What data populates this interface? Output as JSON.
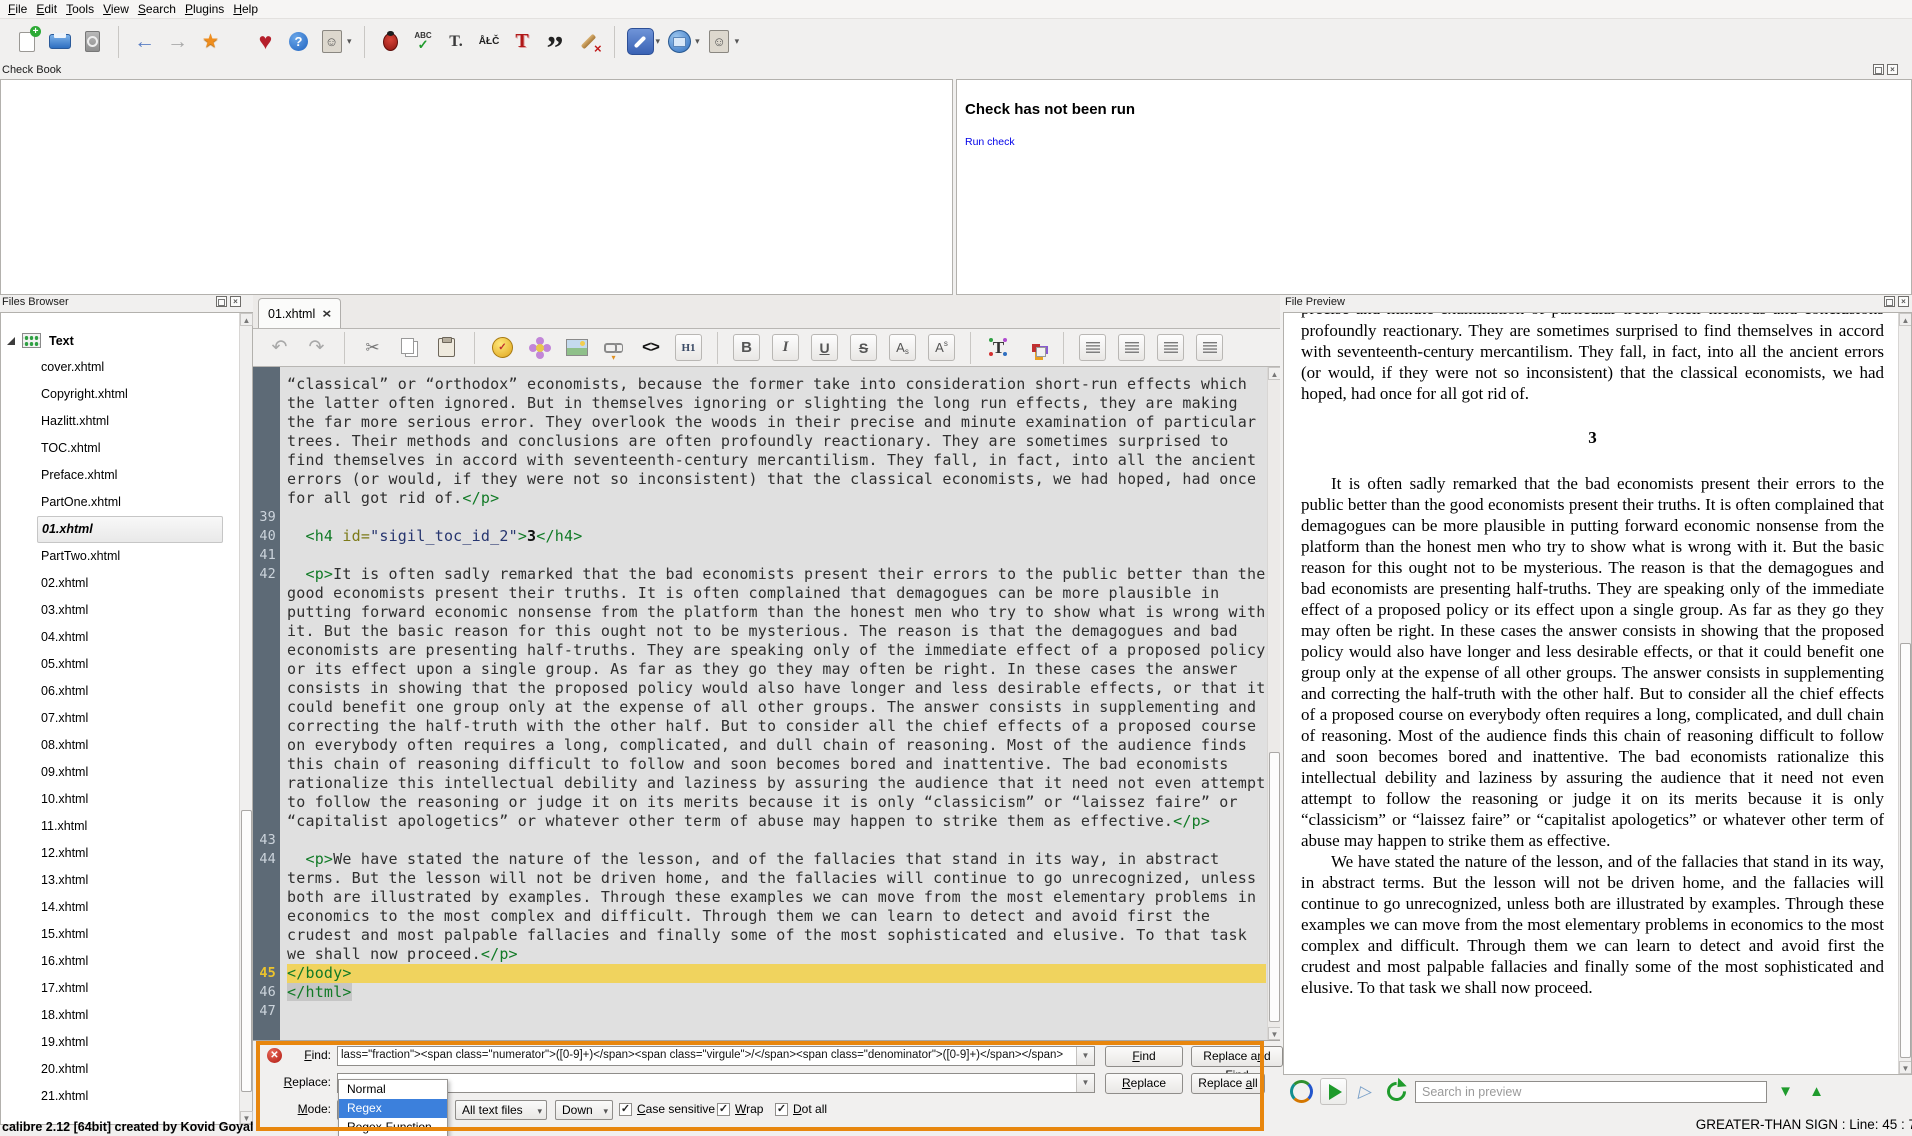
{
  "menu": {
    "items": [
      "&File",
      "&Edit",
      "&Tools",
      "&View",
      "&Search",
      "&Plugins",
      "&Help"
    ]
  },
  "main_toolbar": [
    {
      "n": "new-file-icon",
      "k": "newfile"
    },
    {
      "n": "save-icon",
      "k": "save"
    },
    {
      "n": "book-polish-icon",
      "k": "book"
    },
    {
      "sep": true
    },
    {
      "n": "back-icon",
      "k": "back"
    },
    {
      "n": "forward-icon",
      "k": "forward"
    },
    {
      "n": "bookmark-icon",
      "k": "pin"
    },
    {
      "gap": true
    },
    {
      "n": "donate-icon",
      "k": "heart"
    },
    {
      "n": "help-icon",
      "k": "help"
    },
    {
      "n": "user-manual-icon",
      "k": "avatar",
      "dd": true
    },
    {
      "sep": true
    },
    {
      "n": "check-book-icon",
      "k": "bug"
    },
    {
      "n": "spellcheck-icon",
      "k": "abc"
    },
    {
      "n": "fix-text-icon",
      "k": "tdot"
    },
    {
      "n": "transliterate-icon",
      "k": "alc"
    },
    {
      "n": "remove-formatting-icon",
      "k": "tred"
    },
    {
      "n": "smarten-punctuation-icon",
      "k": "quote"
    },
    {
      "n": "clean-markup-icon",
      "k": "broom"
    },
    {
      "sep": true
    },
    {
      "n": "preferences-icon",
      "k": "wrench",
      "dd": true
    },
    {
      "n": "browser-icon",
      "k": "globe",
      "dd": true
    },
    {
      "n": "user-icon",
      "k": "avatar",
      "dd": true
    }
  ],
  "check_book": {
    "panel_title": "Check Book",
    "heading": "Check has not been run",
    "run_link": "Run check"
  },
  "files_browser": {
    "panel_title": "Files Browser",
    "root_label": "Text",
    "files": [
      {
        "n": "cover.xhtml"
      },
      {
        "n": "Copyright.xhtml"
      },
      {
        "n": "Hazlitt.xhtml"
      },
      {
        "n": "TOC.xhtml"
      },
      {
        "n": "Preface.xhtml"
      },
      {
        "n": "PartOne.xhtml"
      },
      {
        "n": "01.xhtml",
        "sel": true
      },
      {
        "n": "PartTwo.xhtml"
      },
      {
        "n": "02.xhtml"
      },
      {
        "n": "03.xhtml"
      },
      {
        "n": "04.xhtml"
      },
      {
        "n": "05.xhtml"
      },
      {
        "n": "06.xhtml"
      },
      {
        "n": "07.xhtml"
      },
      {
        "n": "08.xhtml"
      },
      {
        "n": "09.xhtml"
      },
      {
        "n": "10.xhtml"
      },
      {
        "n": "11.xhtml"
      },
      {
        "n": "12.xhtml"
      },
      {
        "n": "13.xhtml"
      },
      {
        "n": "14.xhtml"
      },
      {
        "n": "15.xhtml"
      },
      {
        "n": "16.xhtml"
      },
      {
        "n": "17.xhtml"
      },
      {
        "n": "18.xhtml"
      },
      {
        "n": "19.xhtml"
      },
      {
        "n": "20.xhtml"
      },
      {
        "n": "21.xhtml"
      }
    ]
  },
  "editor": {
    "tab_label": "01.xhtml",
    "toolbar": [
      {
        "n": "undo-icon",
        "k": "undo"
      },
      {
        "n": "redo-icon",
        "k": "redo"
      },
      {
        "sep": true
      },
      {
        "n": "cut-icon",
        "k": "cut"
      },
      {
        "n": "copy-icon",
        "k": "copy"
      },
      {
        "n": "paste-icon",
        "k": "paste"
      },
      {
        "sep": true
      },
      {
        "n": "special-character-icon",
        "k": "schar"
      },
      {
        "n": "insert-flower-icon",
        "k": "flower"
      },
      {
        "n": "insert-image-icon",
        "k": "image"
      },
      {
        "n": "insert-link-icon",
        "k": "link"
      },
      {
        "n": "insert-tag-icon",
        "k": "code"
      },
      {
        "n": "heading-icon",
        "k": "h1",
        "b": true
      },
      {
        "sep": true
      },
      {
        "n": "bold-icon",
        "k": "bold",
        "b": true
      },
      {
        "n": "italic-icon",
        "k": "italic",
        "b": true
      },
      {
        "n": "underline-icon",
        "k": "underline",
        "b": true
      },
      {
        "n": "strikethrough-icon",
        "k": "strike",
        "b": true
      },
      {
        "n": "subscript-icon",
        "k": "sub",
        "b": true
      },
      {
        "n": "superscript-icon",
        "k": "sup",
        "b": true
      },
      {
        "sep": true
      },
      {
        "n": "text-color-icon",
        "k": "tcolor"
      },
      {
        "n": "background-color-icon",
        "k": "bgcolor"
      },
      {
        "sep": true
      },
      {
        "n": "align-left-icon",
        "k": "align",
        "b": true
      },
      {
        "n": "align-center-icon",
        "k": "align",
        "b": true
      },
      {
        "n": "align-right-icon",
        "k": "align",
        "b": true
      },
      {
        "n": "align-justify-icon",
        "k": "align",
        "b": true
      }
    ],
    "code_lines": [
      {
        "num": "",
        "segs": [
          {
            "c": "t",
            "s": "“classical” or “orthodox” economists, because the former take into consideration short-run effects which the latter often ignored. But in themselves ignoring or slighting the long run effects, they are making the far more serious error. They overlook the woods in their precise and minute examination of particular trees. Their methods and conclusions are often profoundly reactionary. They are sometimes surprised to find themselves in accord with seventeenth-century mercantilism. They fall, in fact, into all the ancient errors (or would, if they were not so inconsistent) that the classical economists, we had hoped, had once for all got rid of."
          },
          {
            "c": "tag",
            "s": "</p>"
          }
        ]
      },
      {
        "num": "39",
        "segs": []
      },
      {
        "num": "40",
        "segs": [
          {
            "c": "t",
            "s": "  "
          },
          {
            "c": "tag",
            "s": "<h4"
          },
          {
            "c": "t",
            "s": " "
          },
          {
            "c": "attr",
            "s": "id="
          },
          {
            "c": "val",
            "s": "\"sigil_toc_id_2\""
          },
          {
            "c": "tag",
            "s": ">"
          },
          {
            "c": "b",
            "s": "3"
          },
          {
            "c": "tag",
            "s": "</h4>"
          }
        ]
      },
      {
        "num": "41",
        "segs": []
      },
      {
        "num": "42",
        "segs": [
          {
            "c": "t",
            "s": "  "
          },
          {
            "c": "tag",
            "s": "<p>"
          },
          {
            "c": "t",
            "s": "It is often sadly remarked that the bad economists present their errors to the public better than the good economists present their truths. It is often complained that demagogues can be more plausible in putting forward economic nonsense from the platform than the honest men who try to show what is wrong with it. But the basic reason for this ought not to be mysterious. The reason is that the demagogues and bad economists are presenting half-truths. They are speaking only of the immediate effect of a proposed policy or its effect upon a single group. As far as they go they may often be right. In these cases the answer consists in showing that the proposed policy would also have longer and less desirable effects, or that it could benefit one group only at the expense of all other groups. The answer consists in supplementing and correcting the half-truth with the other half. But to consider all the chief effects of a proposed course on everybody often requires a long, complicated, and dull chain of reasoning. Most of the audience finds this chain of reasoning difficult to follow and soon becomes bored and inattentive. The bad economists rationalize this intellectual debility and laziness by assuring the audience that it need not even attempt to follow the reasoning or judge it on its merits because it is only “classicism” or “laissez faire” or “capitalist apologetics” or whatever other term of abuse may happen to strike them as effective."
          },
          {
            "c": "tag",
            "s": "</p>"
          }
        ]
      },
      {
        "num": "43",
        "segs": []
      },
      {
        "num": "44",
        "segs": [
          {
            "c": "t",
            "s": "  "
          },
          {
            "c": "tag",
            "s": "<p>"
          },
          {
            "c": "t",
            "s": "We have stated the nature of the lesson, and of the fallacies that stand in its way, in abstract terms. But the lesson will not be driven home, and the fallacies will continue to go unrecognized, unless both are illustrated by examples. Through these examples we can move from the most elementary problems in economics to the most complex and difficult. Through them we can learn to detect and avoid first the crudest and most palpable fallacies and finally some of the most sophisticated and elusive. To that task we shall now proceed."
          },
          {
            "c": "tag",
            "s": "</p>"
          }
        ]
      },
      {
        "num": "45",
        "hl": true,
        "segs": [
          {
            "c": "tag",
            "s": "</body>"
          }
        ]
      },
      {
        "num": "46",
        "segs": [
          {
            "c": "tag",
            "sel": true,
            "s": "</html>"
          }
        ]
      },
      {
        "num": "47",
        "segs": []
      }
    ]
  },
  "find_replace": {
    "find_label": "&Find:",
    "replace_label": "&Replace:",
    "mode_label": "&Mode:",
    "find_value_visible": "lass=\"fraction\"><span class=\"numerator\">([0-9]+)</span><span class=\"virgule\">/</span><span class=\"denominator\">([0-9]+)</span></span>",
    "replace_value": "",
    "mode_options": [
      "Normal",
      "Regex",
      "Regex-Function"
    ],
    "selected_mode": "Regex",
    "scope_value": "All text files",
    "direction_value": "Down",
    "checkboxes": [
      {
        "label": "&Case sensitive",
        "checked": true
      },
      {
        "label": "&Wrap",
        "checked": true
      },
      {
        "label": "&Dot all",
        "checked": true
      }
    ],
    "buttons": [
      {
        "label": "&Find",
        "cls": "b1"
      },
      {
        "label": "Replace a&nd Find",
        "cls": "b2"
      },
      {
        "label": "&Replace",
        "cls": "b3"
      },
      {
        "label": "Replace &all",
        "cls": "b4"
      }
    ],
    "error_icon": "x-circle"
  },
  "preview": {
    "panel_title": "File Preview",
    "clipped_line": "precise and minute examination of particular trees. Their methods and conclusions are often",
    "paragraphs": [
      {
        "cls": "cont",
        "text": "profoundly reactionary. They are sometimes surprised to find themselves in accord with seventeenth-century mercantilism. They fall, in fact, into all the ancient errors (or would, if they were not so inconsistent) that the classical economists, we had hoped, had once for all got rid of."
      },
      {
        "cls": "heading",
        "text": "3"
      },
      {
        "cls": "ind",
        "text": "It is often sadly remarked that the bad economists present their errors to the public better than the good economists present their truths. It is often complained that demagogues can be more plausible in putting forward economic nonsense from the platform than the honest men who try to show what is wrong with it. But the basic reason for this ought not to be mysterious. The reason is that the demagogues and bad economists are presenting half-truths. They are speaking only of the immediate effect of a proposed policy or its effect upon a single group. As far as they go they may often be right. In these cases the answer consists in showing that the proposed policy would also have longer and less desirable effects, or that it could benefit one group only at the expense of all other groups. The answer consists in supplementing and correcting the half-truth with the other half. But to consider all the chief effects of a proposed course on everybody often requires a long, complicated, and dull chain of reasoning. Most of the audience finds this chain of reasoning difficult to follow and soon becomes bored and inattentive. The bad economists rationalize this intellectual debility and laziness by assuring the audience that it need not even attempt to follow the reasoning or judge it on its merits because it is only “classicism” or “laissez faire” or “capitalist apologetics” or whatever other term of abuse may happen to strike them as effective."
      },
      {
        "cls": "ind",
        "text": "We have stated the nature of the lesson, and of the fallacies that stand in its way, in abstract terms. But the lesson will not be driven home, and the fallacies will continue to go unrecognized, unless both are illustrated by examples. Through these examples we can move from the most elementary problems in economics to the most complex and difficult. Through them we can learn to detect and avoid first the crudest and most palpable fallacies and finally some of the most sophisticated and elusive. To that task we shall now proceed."
      }
    ],
    "search_placeholder": "Search in preview"
  },
  "status_bar": {
    "left": "calibre 2.12 [64bit] created by Kovid Goyal",
    "right": "GREATER-THAN SIGN : Line: 45 : 7"
  }
}
